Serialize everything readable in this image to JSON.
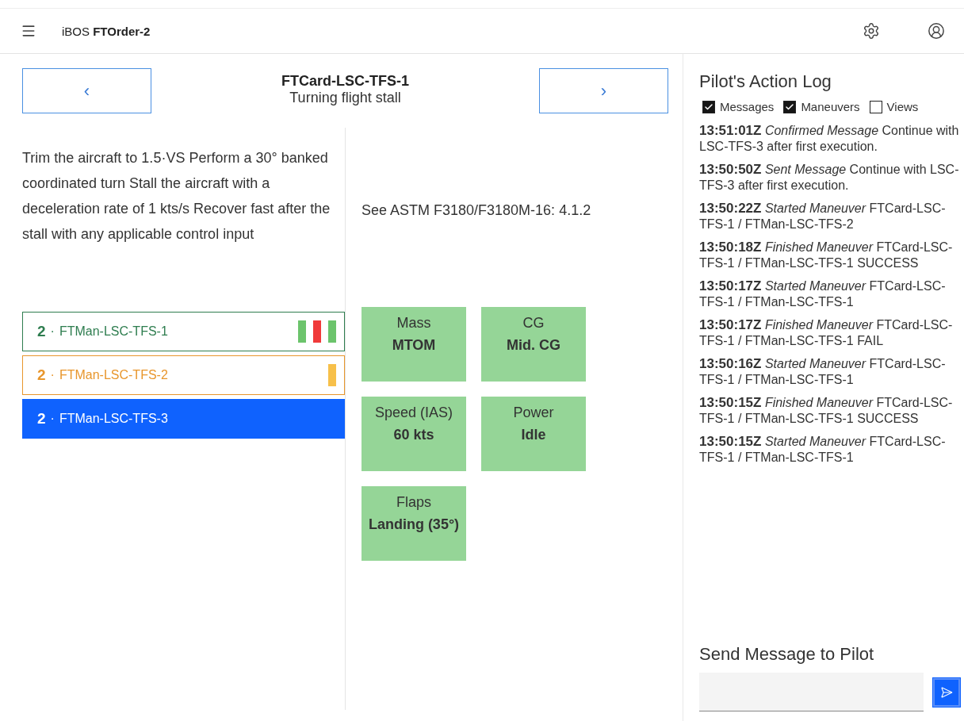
{
  "header": {
    "app": "iBOS",
    "order": "FTOrder-2"
  },
  "card": {
    "prev": "‹",
    "next": "›",
    "id": "FTCard-LSC-TFS-1",
    "name": "Turning flight stall",
    "description": "Trim the aircraft to 1.5·VS Perform a 30° banked coordinated turn Stall the aircraft with a deceleration rate of 1 kts/s Recover fast after the stall with any applicable control input",
    "reference": "See ASTM F3180/F3180M-16: 4.1.2"
  },
  "maneuvers": [
    {
      "number": "2",
      "separator": "·",
      "name": "FTMan-LSC-TFS-1",
      "selected": false,
      "color": "#2e7d4f",
      "results": [
        {
          "color": "#6cc46c"
        },
        {
          "color": "#f03a3a"
        },
        {
          "color": "#6cc46c"
        }
      ]
    },
    {
      "number": "2",
      "separator": "·",
      "name": "FTMan-LSC-TFS-2",
      "selected": false,
      "color": "#e8962c",
      "results": [
        {
          "color": "#f7c04a"
        }
      ]
    },
    {
      "number": "2",
      "separator": "·",
      "name": "FTMan-LSC-TFS-3",
      "selected": true,
      "color": "#0f62fe"
    }
  ],
  "parameters": [
    {
      "label": "Mass",
      "value": "MTOM"
    },
    {
      "label": "CG",
      "value": "Mid. CG"
    },
    {
      "label": "Speed (IAS)",
      "value": "60 kts"
    },
    {
      "label": "Power",
      "value": "Idle"
    },
    {
      "label": "Flaps",
      "value": "Landing (35°)"
    }
  ],
  "log": {
    "title": "Pilot's Action Log",
    "filters": [
      {
        "label": "Messages",
        "checked": true
      },
      {
        "label": "Maneuvers",
        "checked": true
      },
      {
        "label": "Views",
        "checked": false
      }
    ],
    "entries": [
      "**13:51:01Z** *Confirmed Message* Continue with LSC-TFS-3 after first execution.",
      "**13:50:50Z** *Sent Message* Continue with LSC-TFS-3 after first execution.",
      "**13:50:22Z** *Started Maneuver* FTCard-LSC-TFS-1 / FTMan-LSC-TFS-2",
      "**13:50:18Z** *Finished Maneuver* FTCard-LSC-TFS-1 / FTMan-LSC-TFS-1 SUCCESS",
      "**13:50:17Z** *Started Maneuver* FTCard-LSC-TFS-1 / FTMan-LSC-TFS-1",
      "**13:50:17Z** *Finished Maneuver* FTCard-LSC-TFS-1 / FTMan-LSC-TFS-1 FAIL",
      "**13:50:16Z** *Started Maneuver* FTCard-LSC-TFS-1 / FTMan-LSC-TFS-1",
      "**13:50:15Z** *Finished Maneuver* FTCard-LSC-TFS-1 / FTMan-LSC-TFS-1 SUCCESS",
      "**13:50:15Z** *Started Maneuver* FTCard-LSC-TFS-1 / FTMan-LSC-TFS-1"
    ],
    "send_title": "Send Message to Pilot"
  }
}
